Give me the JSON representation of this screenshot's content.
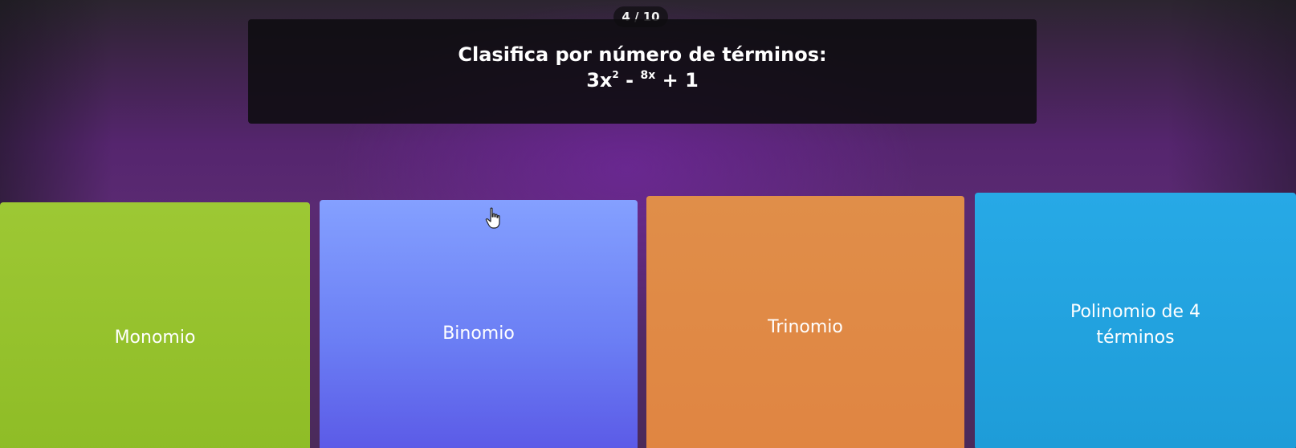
{
  "progress": {
    "counter": "4 / 10"
  },
  "question": {
    "prompt": "Clasifica por número de términos:",
    "expression": {
      "term1_base": "3x",
      "term1_exp": "2",
      "op1": " - ",
      "term2": "8x",
      "op2": " + ",
      "term3": "1"
    }
  },
  "options": [
    {
      "label": "Monomio",
      "color": "#9dc834"
    },
    {
      "label": "Binomio",
      "color": "#6b7ef4"
    },
    {
      "label": "Trinomio",
      "color": "#e08542"
    },
    {
      "label": "Polinomio de 4 términos",
      "color": "#1e9cd8"
    }
  ],
  "cursor_icon": "hand-pointer-icon"
}
